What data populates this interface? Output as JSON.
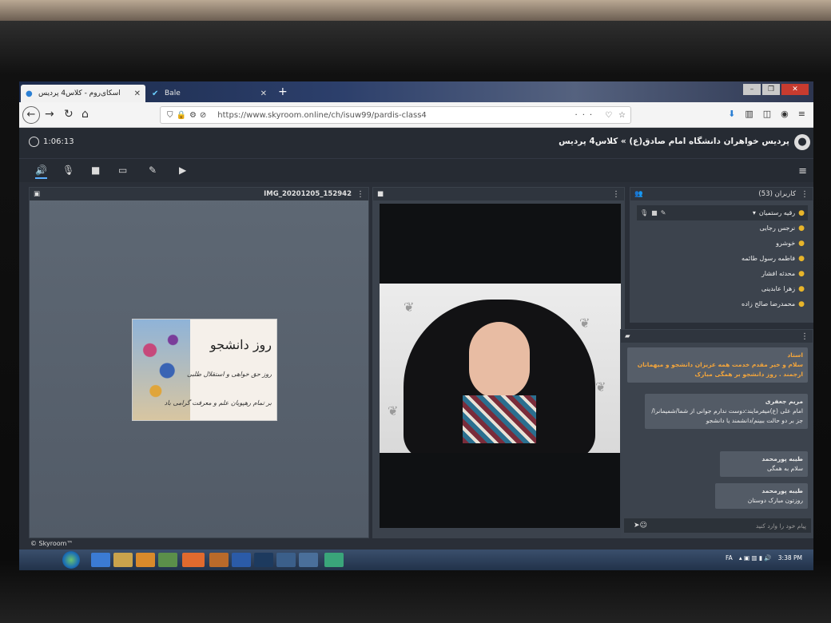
{
  "browser": {
    "tabs": [
      {
        "label": "اسکای‌روم - کلاس4 پردیس",
        "active": true
      },
      {
        "label": "Bale",
        "active": false
      }
    ],
    "url": "https://www.skyroom.online/ch/isuw99/pardis-class4"
  },
  "app": {
    "timer": "1:06:13",
    "room_title": "پردیس خواهران دانشگاه امام صادق(ع) » کلاس4 پردیس",
    "brand": "© Skyroom™"
  },
  "presentation": {
    "file_name": "IMG_20201205_152942",
    "slide_title": "روز دانشجو",
    "slide_lines": [
      "روز حق خواهی و استقلال طلبی",
      "بر تمام رهپویان علم و معرفت گرامی باد"
    ]
  },
  "users": {
    "title": "کاربران (53)",
    "list": [
      "رقیه رستمیان",
      "نرجس رجایی",
      "خوشرو",
      "فاطمه رسول طائمه",
      "محدثه افشار",
      "زهرا عابدینی",
      "محمدرضا صالح زاده"
    ]
  },
  "chat": {
    "messages": [
      {
        "who": "استاد",
        "body": "سلام و خیر مقدم خدمت همه عزیزان دانشجو و میهمانان ارجمند . روز دانشجو بر همگی مبارک"
      },
      {
        "who": "مریم جعفری",
        "body": "امام علی (ع)میفرمایند:دوست ندارم جوانی از شما/شمیمانرا/جز بر دو حالت ببینم/دانشمند یا دانشجو"
      },
      {
        "who": "طیبه پورمحمد",
        "body": "سلام به همگی"
      },
      {
        "who": "طیبه پورمحمد",
        "body": "روزتون مبارک دوستان"
      }
    ],
    "input_placeholder": "پیام خود را وارد کنید"
  },
  "taskbar": {
    "lang": "FA",
    "time": "3:38 PM"
  },
  "colors": {
    "accent": "#5db0ff",
    "teacher": "#f3a53b",
    "user_icon": "#e8b52a"
  }
}
